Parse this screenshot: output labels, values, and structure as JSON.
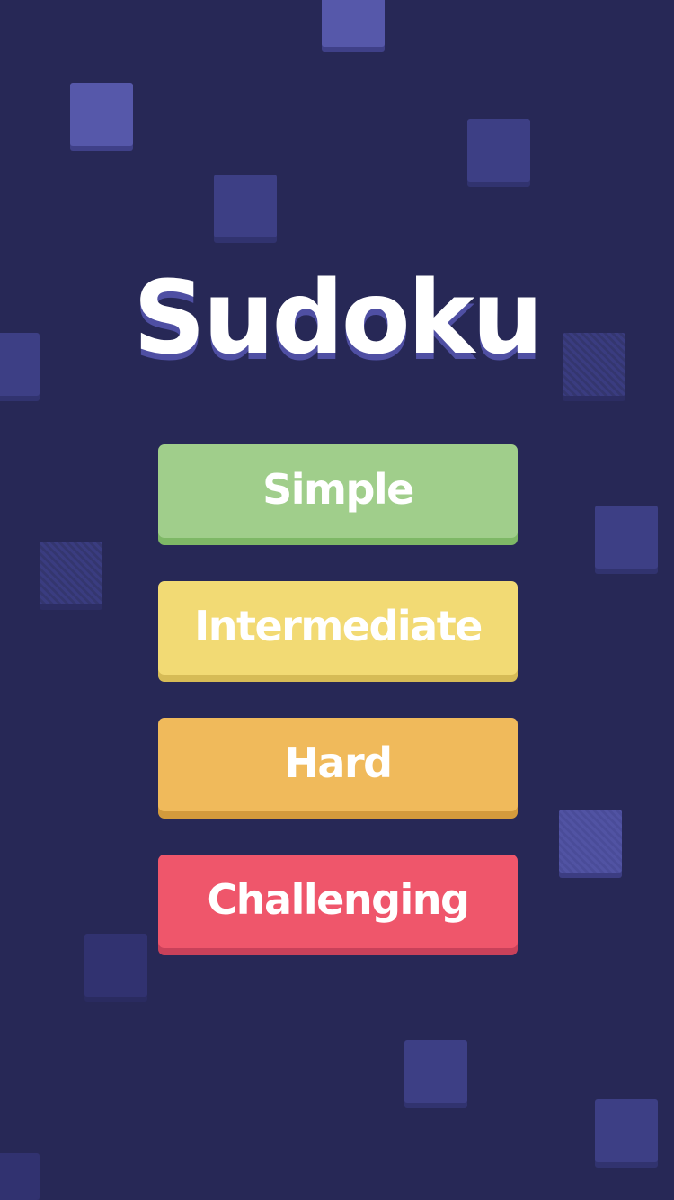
{
  "app": {
    "title": "Sudoku"
  },
  "menu": {
    "difficulties": [
      {
        "label": "Simple",
        "color": "#a0ce8b"
      },
      {
        "label": "Intermediate",
        "color": "#f2da74"
      },
      {
        "label": "Hard",
        "color": "#f0ba5b"
      },
      {
        "label": "Challenging",
        "color": "#ef566b"
      }
    ]
  },
  "theme": {
    "background": "#272856",
    "tile_bright": "#5658aa",
    "tile_dim": "#313270"
  }
}
